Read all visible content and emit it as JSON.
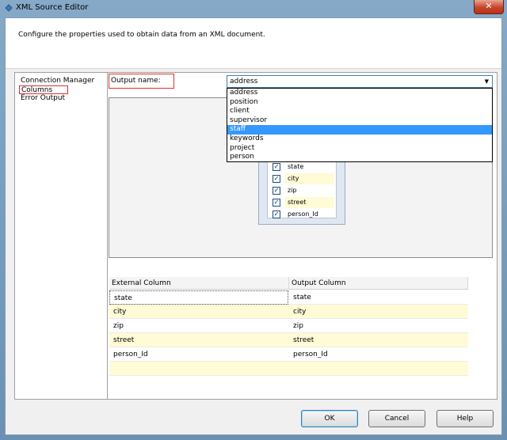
{
  "window": {
    "title": "XML Source Editor",
    "close_glyph": "✕"
  },
  "header": {
    "description": "Configure the properties used to obtain data from an XML document."
  },
  "nav": {
    "items": [
      "Connection Manager",
      "Columns",
      "Error Output"
    ],
    "selected_index": 1
  },
  "output": {
    "label": "Output name:",
    "selected_value": "address",
    "options": [
      "address",
      "position",
      "client",
      "supervisor",
      "staff",
      "keywords",
      "project",
      "person"
    ],
    "highlighted_index": 4
  },
  "table_box": {
    "columns": [
      {
        "name": "state",
        "checked": true
      },
      {
        "name": "city",
        "checked": true
      },
      {
        "name": "zip",
        "checked": true
      },
      {
        "name": "street",
        "checked": true
      },
      {
        "name": "person_Id",
        "checked": true
      }
    ]
  },
  "grid": {
    "headers": [
      "External Column",
      "Output Column"
    ],
    "rows": [
      [
        "state",
        "state"
      ],
      [
        "city",
        "city"
      ],
      [
        "zip",
        "zip"
      ],
      [
        "street",
        "street"
      ],
      [
        "person_Id",
        "person_Id"
      ],
      [
        "",
        ""
      ]
    ]
  },
  "buttons": {
    "ok": "OK",
    "cancel": "Cancel",
    "help": "Help"
  },
  "colors": {
    "highlight": "#3399ff",
    "selection_border": "#e03030",
    "alt_row": "#fffbd6"
  },
  "icons": {
    "title": "app-icon",
    "combo": "chevron-down-icon",
    "checkbox": "check-icon"
  }
}
